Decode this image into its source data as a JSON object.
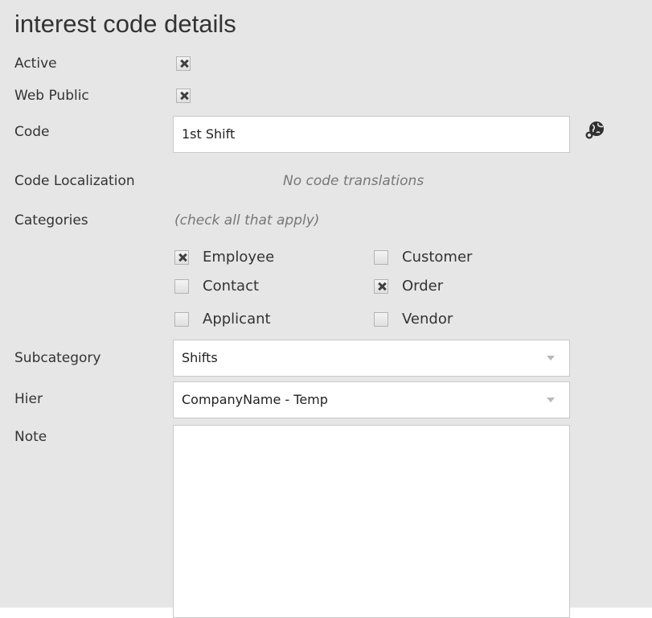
{
  "title": "interest code details",
  "active": {
    "label": "Active",
    "checked": true
  },
  "web_public": {
    "label": "Web Public",
    "checked": true
  },
  "code": {
    "label": "Code",
    "value": "1st Shift",
    "icon": "globe-translate-icon"
  },
  "localization": {
    "label": "Code Localization",
    "empty_text": "No code translations"
  },
  "categories": {
    "label": "Categories",
    "hint": "(check all that apply)",
    "items": [
      {
        "label": "Employee",
        "checked": true
      },
      {
        "label": "Customer",
        "checked": false
      },
      {
        "label": "Contact",
        "checked": false
      },
      {
        "label": "Order",
        "checked": true
      },
      {
        "label": "Applicant",
        "checked": false
      },
      {
        "label": "Vendor",
        "checked": false
      }
    ]
  },
  "subcategory": {
    "label": "Subcategory",
    "value": "Shifts"
  },
  "hier": {
    "label": "Hier",
    "value": "CompanyName - Temp"
  },
  "note": {
    "label": "Note",
    "value": ""
  }
}
